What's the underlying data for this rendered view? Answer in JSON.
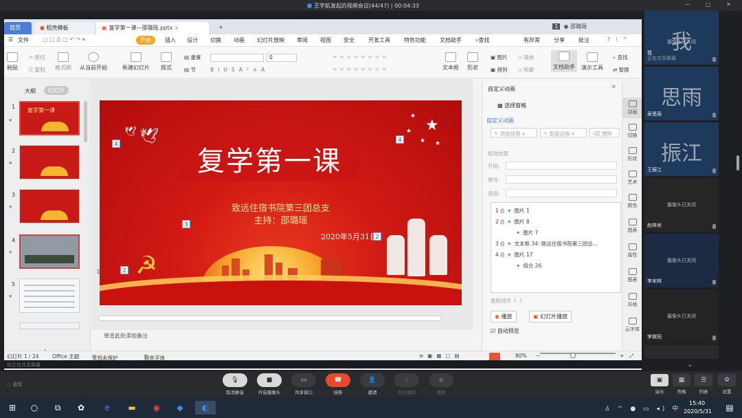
{
  "meeting": {
    "title": "王宇航发起的视频会议(44/47)",
    "timer": "00:04:33"
  },
  "wps": {
    "tabs": [
      {
        "label": "首页"
      },
      {
        "label": "稻壳模板"
      },
      {
        "label": "复学第一课—邵璐瑶.pptx"
      }
    ],
    "page_badge": "1",
    "user": "邵璐瑶",
    "menu": [
      "文件",
      "开始",
      "插入",
      "设计",
      "切换",
      "动画",
      "幻灯片放映",
      "审阅",
      "视图",
      "安全",
      "开发工具",
      "特色功能",
      "文档助手"
    ],
    "menu_search": "查找",
    "menu_right": [
      "有异常",
      "分享",
      "批注"
    ],
    "ribbon": {
      "paste": "粘贴",
      "cut": "剪切",
      "copy": "复制",
      "format_painter": "格式刷",
      "from_current": "从当前开始",
      "new_slide": "新建幻灯片",
      "layout": "版式",
      "section": "节",
      "reset": "重置",
      "font_size": "0",
      "text_box": "文本框",
      "shape": "形状",
      "arrange": "排列",
      "picture": "图片",
      "fill": "填充",
      "outline": "轮廓",
      "doc_helper": "文档助手",
      "presenter_tools": "演示工具",
      "find": "查找",
      "replace": "替换"
    },
    "left_panel": {
      "outline_tab": "大纲",
      "slides_tab": "幻灯片",
      "thumb_title": "复学第一课",
      "slide_numbers": [
        "1",
        "2",
        "3",
        "4",
        "5"
      ]
    },
    "slide": {
      "title": "复学第一课",
      "org": "致远住宿书院第三团总支",
      "host": "主持：邵璐瑶",
      "date": "2020年5月31日",
      "anim_tags": [
        "4",
        "4",
        "3",
        "2",
        "2",
        "1"
      ]
    },
    "notes_placeholder": "单击此处添加备注",
    "pane": {
      "title": "自定义动画",
      "select_pane": "选择窗格",
      "custom_anim": "自定义动画",
      "add_effect": "添加效果",
      "smart_anim": "智能动画",
      "delete": "删除",
      "modify_effect": "修改效果",
      "start_label": "开始:",
      "property_label": "属性:",
      "speed_label": "速度:",
      "anim_items": [
        {
          "num": "1",
          "text": "图片 1"
        },
        {
          "num": "2",
          "text": "图片 8"
        },
        {
          "num": "",
          "text": "图片 7"
        },
        {
          "num": "3",
          "text": "文本框 34: 致远住宿书院第三团总..."
        },
        {
          "num": "4",
          "text": "图片 17"
        },
        {
          "num": "",
          "text": "组合 26"
        }
      ],
      "reorder": "重新排序",
      "play": "播放",
      "slideshow": "幻灯片播放",
      "auto_preview": "自动预览"
    },
    "iconbar": [
      "动画",
      "切换",
      "形状",
      "艺术",
      "颜色",
      "图表",
      "属性",
      "图表",
      "风格",
      "云字体"
    ],
    "status": {
      "slide_pos": "幻灯片 1 / 24",
      "theme": "Office 主题",
      "protect": "文档未保护",
      "missing_font": "缺失字体",
      "zoom": "80%"
    },
    "share_status": "你正在共享屏幕"
  },
  "participants": [
    {
      "name": "我",
      "avatar_text": "我",
      "sub": "正在共享屏幕",
      "camera": "摄像头已关闭"
    },
    {
      "name": "吴思雨",
      "avatar_text": "思雨",
      "camera": ""
    },
    {
      "name": "王振江",
      "avatar_text": "振江",
      "camera": ""
    },
    {
      "name": "赵梓尚",
      "avatar_text": "",
      "camera": "摄像头已关闭"
    },
    {
      "name": "李宋林",
      "avatar_text": "",
      "camera": "摄像头已关闭"
    },
    {
      "name": "李致阳",
      "avatar_text": "",
      "camera": "摄像头已关闭"
    }
  ],
  "controls": {
    "hint": "会议",
    "buttons": [
      "取消静音",
      "开启摄像头",
      "共享窗口",
      "挂断",
      "邀请",
      "会议录制",
      "录制"
    ],
    "right": [
      "演示",
      "宫格",
      "列表",
      "设置"
    ]
  },
  "taskbar": {
    "time": "15:40",
    "date": "2020/5/31",
    "ime": "中"
  }
}
